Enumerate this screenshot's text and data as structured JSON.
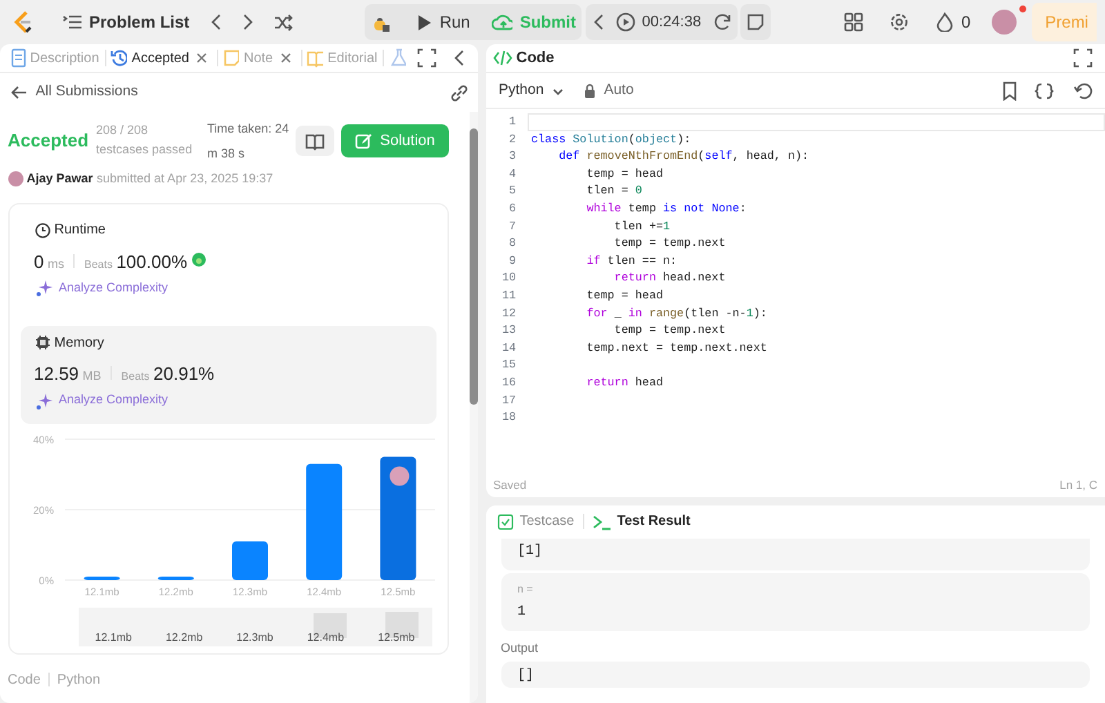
{
  "top_bar": {
    "problem_list": "Problem List",
    "run": "Run",
    "submit": "Submit",
    "timer": "00:24:38",
    "streak": "0",
    "notification_dot": true,
    "premium": "Premi"
  },
  "left_tabs": [
    {
      "kind": "doc",
      "label": "Description",
      "selected": false,
      "closable": false
    },
    {
      "kind": "history",
      "label": "Accepted",
      "selected": true,
      "closable": true
    },
    {
      "kind": "note",
      "label": "Note",
      "selected": false,
      "closable": true
    },
    {
      "kind": "book",
      "label": "Editorial",
      "selected": false,
      "closable": false
    },
    {
      "kind": "flask",
      "selected": false,
      "closable": false
    }
  ],
  "back_link": "All Submissions",
  "result": {
    "status": "Accepted",
    "testcases": "208 / 208 testcases passed",
    "time_taken": "Time taken: 24 m 38 s",
    "solution_button": "Solution",
    "author": "Ajay Pawar",
    "submitted": "submitted at Apr 23, 2025 19:37"
  },
  "metrics": [
    {
      "kind": "runtime",
      "title": "Runtime",
      "value": "0",
      "unit": "ms",
      "beats_label": "Beats",
      "beats": "100.00%",
      "badge": true,
      "analyze": "Analyze Complexity",
      "selected": false
    },
    {
      "kind": "memory",
      "title": "Memory",
      "value": "12.59",
      "unit": "MB",
      "beats_label": "Beats",
      "beats": "20.91%",
      "badge": false,
      "analyze": "Analyze Complexity",
      "selected": true
    }
  ],
  "chart_data": {
    "type": "bar",
    "categories": [
      "12.1mb",
      "12.2mb",
      "12.3mb",
      "12.4mb",
      "12.5mb"
    ],
    "values": [
      1,
      1,
      11,
      33,
      35
    ],
    "ylim": [
      0,
      40
    ],
    "yticks": [
      {
        "value": 0,
        "label": "0%"
      },
      {
        "value": 20,
        "label": "20%"
      },
      {
        "value": 40,
        "label": "40%"
      }
    ]
  },
  "overview_labels": [
    "12.1mb",
    "12.2mb",
    "12.3mb",
    "12.4mb",
    "12.5mb"
  ],
  "bottom_strip": {
    "code": "Code",
    "language": "Python"
  },
  "editor": {
    "title": "Code",
    "language": "Python",
    "mode": "Auto",
    "saved": "Saved",
    "cursor": "Ln 1, C",
    "lines": [
      {
        "number": "1",
        "current": true
      },
      {
        "number": "2",
        "current": false,
        "tokens": [
          {
            "kind": "kw",
            "text": "class "
          },
          {
            "kind": "cls",
            "text": "Solution"
          },
          {
            "kind": "t",
            "text": "("
          },
          {
            "kind": "cls",
            "text": "object"
          },
          {
            "kind": "t",
            "text": "):"
          }
        ]
      },
      {
        "number": "3",
        "current": false,
        "tokens": [
          {
            "kind": "kw",
            "text": "    def "
          },
          {
            "kind": "fn",
            "text": "removeNthFromEnd"
          },
          {
            "kind": "t",
            "text": "("
          },
          {
            "kind": "kw",
            "text": "self"
          },
          {
            "kind": "t",
            "text": ", head, n):"
          }
        ]
      },
      {
        "number": "4",
        "current": false,
        "tokens": [
          {
            "kind": "t",
            "text": "        temp = head"
          }
        ]
      },
      {
        "number": "5",
        "current": false,
        "tokens": [
          {
            "kind": "t",
            "text": "        tlen = "
          },
          {
            "kind": "num",
            "text": "0"
          }
        ]
      },
      {
        "number": "6",
        "current": false,
        "tokens": [
          {
            "kind": "ctl",
            "text": "        while "
          },
          {
            "kind": "t",
            "text": "temp "
          },
          {
            "kind": "kw",
            "text": "is not None"
          },
          {
            "kind": "t",
            "text": ":"
          }
        ]
      },
      {
        "number": "7",
        "current": false,
        "tokens": [
          {
            "kind": "t",
            "text": "            tlen +="
          },
          {
            "kind": "num",
            "text": "1"
          }
        ]
      },
      {
        "number": "8",
        "current": false,
        "tokens": [
          {
            "kind": "t",
            "text": "            temp = temp.next"
          }
        ]
      },
      {
        "number": "9",
        "current": false,
        "tokens": [
          {
            "kind": "ctl",
            "text": "        if "
          },
          {
            "kind": "t",
            "text": "tlen == n:"
          }
        ]
      },
      {
        "number": "10",
        "current": false,
        "tokens": [
          {
            "kind": "ctl",
            "text": "            return "
          },
          {
            "kind": "t",
            "text": "head.next"
          }
        ]
      },
      {
        "number": "11",
        "current": false,
        "tokens": [
          {
            "kind": "t",
            "text": "        temp = head"
          }
        ]
      },
      {
        "number": "12",
        "current": false,
        "tokens": [
          {
            "kind": "ctl",
            "text": "        for "
          },
          {
            "kind": "t",
            "text": "_ "
          },
          {
            "kind": "ctl",
            "text": "in "
          },
          {
            "kind": "fn",
            "text": "range"
          },
          {
            "kind": "t",
            "text": "(tlen -n-"
          },
          {
            "kind": "num",
            "text": "1"
          },
          {
            "kind": "t",
            "text": "):"
          }
        ]
      },
      {
        "number": "13",
        "current": false,
        "tokens": [
          {
            "kind": "t",
            "text": "            temp = temp.next"
          }
        ]
      },
      {
        "number": "14",
        "current": false,
        "tokens": [
          {
            "kind": "t",
            "text": "        temp.next = temp.next.next"
          }
        ]
      },
      {
        "number": "15",
        "current": false
      },
      {
        "number": "16",
        "current": false,
        "tokens": [
          {
            "kind": "ctl",
            "text": "        return "
          },
          {
            "kind": "t",
            "text": "head"
          }
        ]
      },
      {
        "number": "17",
        "current": false
      },
      {
        "number": "18",
        "current": false
      }
    ]
  },
  "console": {
    "tabs": [
      {
        "kind": "testcase",
        "label": "Testcase",
        "selected": false
      },
      {
        "kind": "result",
        "label": "Test Result",
        "selected": true
      }
    ],
    "input_tail": "[1]",
    "params": [
      {
        "name": "n =",
        "value": "1"
      }
    ],
    "output_label": "Output",
    "output": "[]"
  }
}
